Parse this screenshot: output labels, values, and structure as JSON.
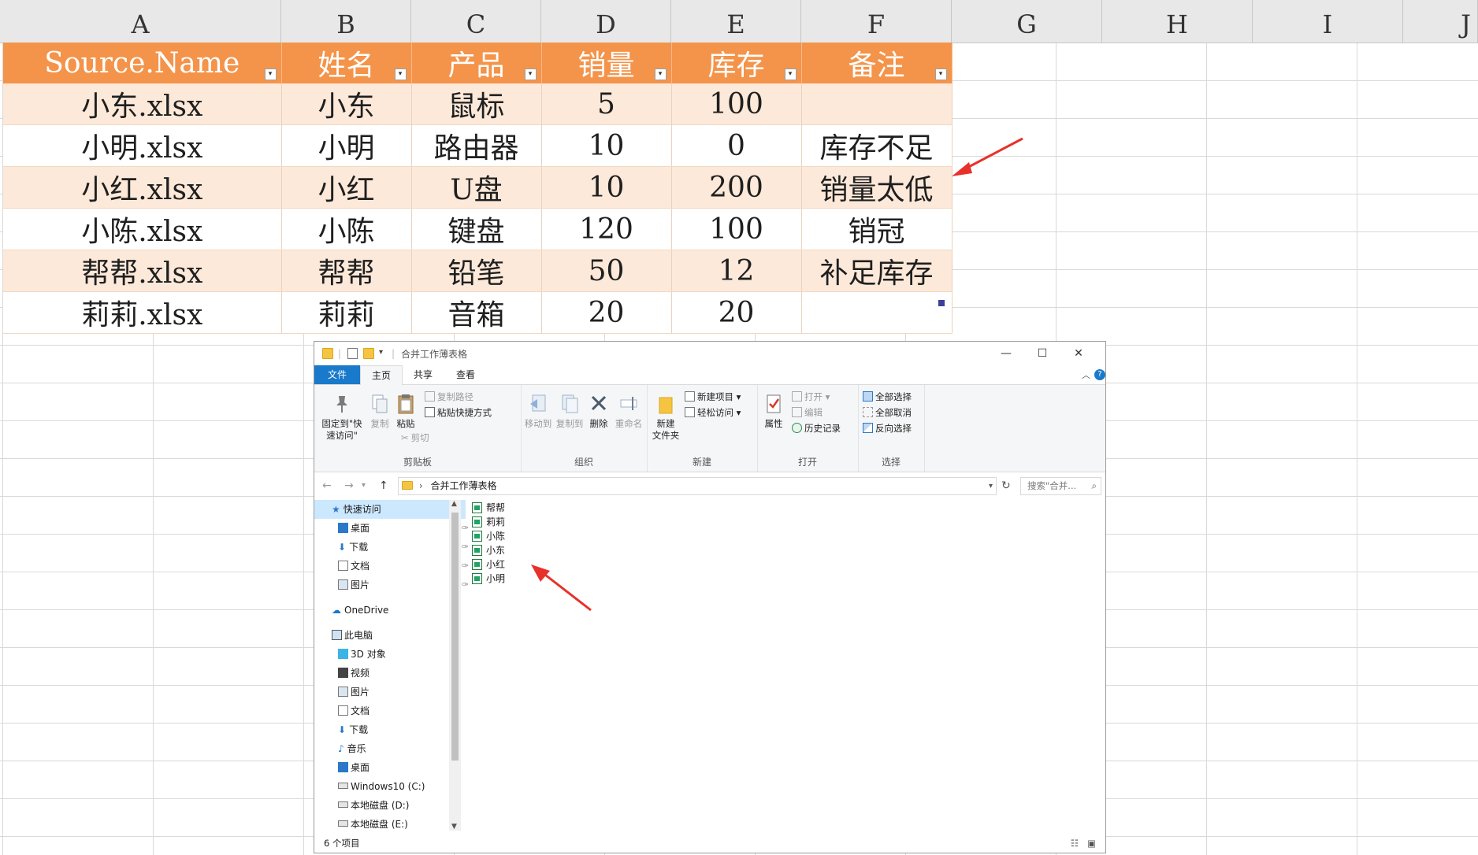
{
  "spreadsheet": {
    "columns": [
      "A",
      "B",
      "C",
      "D",
      "E",
      "F",
      "G",
      "H",
      "I",
      "J"
    ],
    "table": {
      "headers": [
        "Source.Name",
        "姓名",
        "产品",
        "销量",
        "库存",
        "备注"
      ],
      "filter_icon": "filter-dropdown-icon",
      "rows": [
        [
          "小东.xlsx",
          "小东",
          "鼠标",
          "5",
          "100",
          ""
        ],
        [
          "小明.xlsx",
          "小明",
          "路由器",
          "10",
          "0",
          "库存不足"
        ],
        [
          "小红.xlsx",
          "小红",
          "U盘",
          "10",
          "200",
          "销量太低"
        ],
        [
          "小陈.xlsx",
          "小陈",
          "键盘",
          "120",
          "100",
          "销冠"
        ],
        [
          "帮帮.xlsx",
          "帮帮",
          "铅笔",
          "50",
          "12",
          "补足库存"
        ],
        [
          "莉莉.xlsx",
          "莉莉",
          "音箱",
          "20",
          "20",
          ""
        ]
      ]
    },
    "colors": {
      "header_bg": "#f4944a",
      "band_bg": "#fde9d9",
      "arrow": "#e8312a"
    }
  },
  "explorer": {
    "title": "合并工作薄表格",
    "tabs": {
      "file": "文件",
      "home": "主页",
      "share": "共享",
      "view": "查看"
    },
    "ribbon": {
      "pin_quick_access": "固定到\"快速访问\"",
      "copy": "复制",
      "paste": "粘贴",
      "copy_path": "复制路径",
      "paste_shortcut": "粘贴快捷方式",
      "cut": "剪切",
      "clipboard_group": "剪贴板",
      "move_to": "移动到",
      "copy_to": "复制到",
      "delete": "删除",
      "rename": "重命名",
      "organize_group": "组织",
      "new_folder": "新建\n文件夹",
      "new_item": "新建项目",
      "easy_access": "轻松访问",
      "new_group": "新建",
      "properties": "属性",
      "open": "打开",
      "edit": "编辑",
      "history": "历史记录",
      "open_group": "打开",
      "select_all": "全部选择",
      "select_none": "全部取消",
      "invert_selection": "反向选择",
      "select_group": "选择"
    },
    "address": "合并工作薄表格",
    "search_placeholder": "搜索\"合并...",
    "nav": {
      "quick_access": "快速访问",
      "desktop": "桌面",
      "downloads": "下载",
      "documents": "文档",
      "pictures": "图片",
      "onedrive": "OneDrive",
      "this_pc": "此电脑",
      "objects_3d": "3D 对象",
      "videos": "视频",
      "pictures2": "图片",
      "documents2": "文档",
      "downloads2": "下载",
      "music": "音乐",
      "desktop2": "桌面",
      "drive_c": "Windows10 (C:)",
      "drive_d": "本地磁盘 (D:)",
      "drive_e": "本地磁盘 (E:)"
    },
    "files": [
      "帮帮",
      "莉莉",
      "小陈",
      "小东",
      "小红",
      "小明"
    ],
    "status": "6 个项目"
  }
}
